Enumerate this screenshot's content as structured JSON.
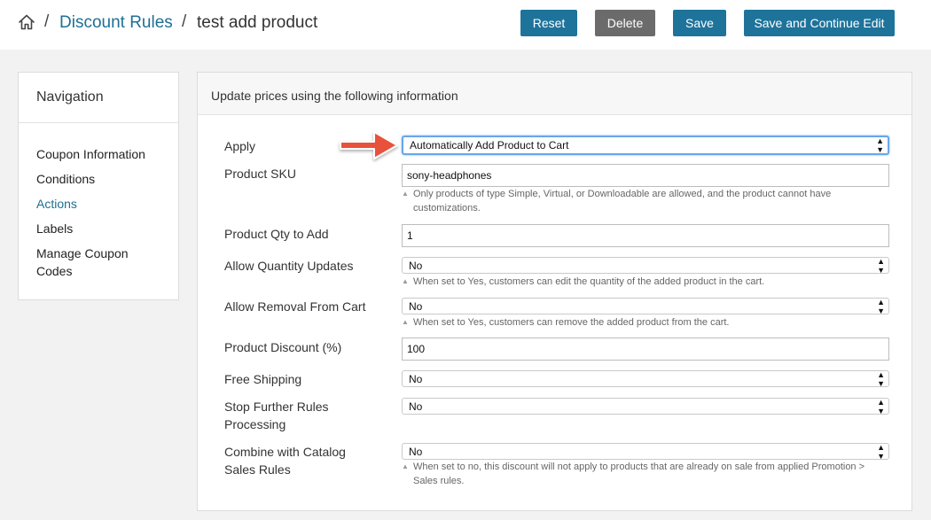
{
  "breadcrumb": {
    "home_icon": "home-icon",
    "separator": "/",
    "parent": "Discount Rules",
    "current": "test add product"
  },
  "toolbar": {
    "reset_label": "Reset",
    "delete_label": "Delete",
    "save_label": "Save",
    "save_continue_label": "Save and Continue Edit"
  },
  "navigation": {
    "title": "Navigation",
    "items": [
      {
        "label": "Coupon Information"
      },
      {
        "label": "Conditions"
      },
      {
        "label": "Actions"
      },
      {
        "label": "Labels"
      },
      {
        "label": "Manage Coupon Codes"
      }
    ],
    "active_index": 2
  },
  "form": {
    "title": "Update prices using the following information",
    "apply": {
      "label": "Apply",
      "value": "Automatically Add Product to Cart"
    },
    "sku": {
      "label": "Product SKU",
      "value": "sony-headphones",
      "note": "Only products of type Simple, Virtual, or Downloadable are allowed, and the product cannot have customizations."
    },
    "qty": {
      "label": "Product Qty to Add",
      "value": "1"
    },
    "allow_qty_updates": {
      "label": "Allow Quantity Updates",
      "value": "No",
      "note": "When set to Yes, customers can edit the quantity of the added product in the cart."
    },
    "allow_removal": {
      "label": "Allow Removal From Cart",
      "value": "No",
      "note": "When set to Yes, customers can remove the added product from the cart."
    },
    "discount": {
      "label": "Product Discount (%)",
      "value": "100"
    },
    "free_shipping": {
      "label": "Free Shipping",
      "value": "No"
    },
    "stop_rules": {
      "label": "Stop Further Rules Processing",
      "value": "No"
    },
    "combine_catalog": {
      "label": "Combine with Catalog Sales Rules",
      "value": "No",
      "note": "When set to no, this discount will not apply to products that are already on sale from applied Promotion > Sales rules."
    }
  },
  "colors": {
    "accent": "#1e739b",
    "link": "#1f6f93",
    "secondary_button": "#6b6b6b",
    "annotation_arrow": "#e8513a"
  }
}
